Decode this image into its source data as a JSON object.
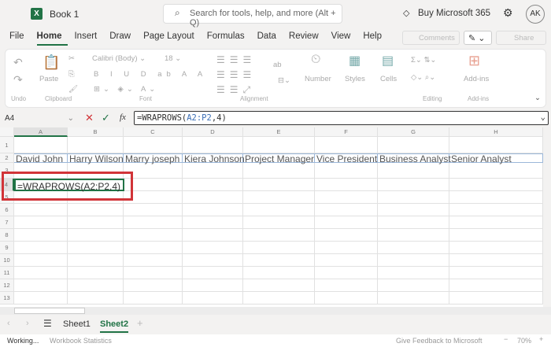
{
  "app": {
    "book_title": "Book 1",
    "search_placeholder": "Search for tools, help, and more (Alt + Q)",
    "buy": "Buy Microsoft 365",
    "avatar": "AK"
  },
  "menu": {
    "tabs": [
      "File",
      "Home",
      "Insert",
      "Draw",
      "Page Layout",
      "Formulas",
      "Data",
      "Review",
      "View",
      "Help"
    ],
    "comments": "Comments",
    "share": "Share"
  },
  "ribbon": {
    "font_name": "Calibri (Body)",
    "font_size": "18",
    "paste": "Paste",
    "number": "Number",
    "styles": "Styles",
    "cells": "Cells",
    "addins": "Add-ins",
    "groups": [
      "Undo",
      "Clipboard",
      "Font",
      "Alignment",
      "Editing",
      "Add-ins"
    ]
  },
  "formula_bar": {
    "name_box": "A4",
    "fx": "fx",
    "formula": "=WRAPROWS(A2:P2,4)"
  },
  "grid": {
    "columns": [
      "A",
      "B",
      "C",
      "D",
      "E",
      "F",
      "G",
      "H"
    ],
    "rows": [
      "1",
      "2",
      "3",
      "4",
      "5",
      "6",
      "7",
      "8",
      "9",
      "10",
      "11",
      "12",
      "13"
    ],
    "row2": [
      "David John",
      "Harry Wilson",
      "Marry joseph",
      "Kiera Johnson",
      "Project Manager",
      "Vice President",
      "Business Analyst",
      "Senior Analyst"
    ],
    "a4": "=WRAPROWS(A2:P2,4)"
  },
  "sheets": {
    "tabs": [
      "Sheet1",
      "Sheet2"
    ],
    "active": "Sheet2"
  },
  "status": {
    "working": "Working...",
    "stats": "Workbook Statistics",
    "feedback": "Give Feedback to Microsoft",
    "zoom": "70%"
  },
  "colors": {
    "accent": "#217346",
    "highlight": "#d13438"
  }
}
